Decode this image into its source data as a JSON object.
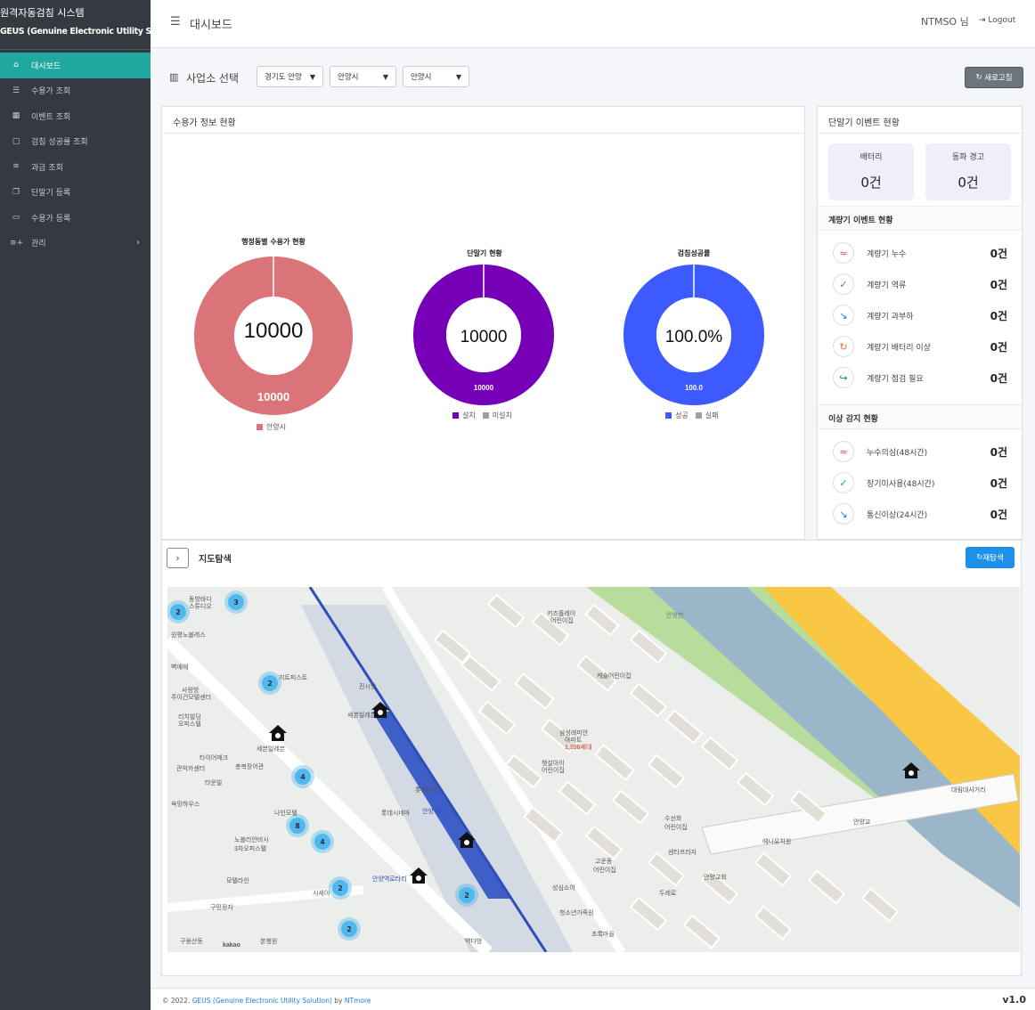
{
  "sidebar": {
    "title": "원격자동검침 시스템",
    "subtitle": "GEUS (Genuine Electronic Utility Solution)",
    "items": [
      {
        "label": "대시보드",
        "icon": "home-icon"
      },
      {
        "label": "수용가 조회",
        "icon": "list-icon"
      },
      {
        "label": "이벤트 조회",
        "icon": "grid-icon"
      },
      {
        "label": "검침 성공률 조회",
        "icon": "document-icon"
      },
      {
        "label": "과금 조회",
        "icon": "coins-icon"
      },
      {
        "label": "단말기 등록",
        "icon": "copy-icon"
      },
      {
        "label": "수용가 등록",
        "icon": "clipboard-icon"
      },
      {
        "label": "관리",
        "icon": "add-list-icon"
      }
    ]
  },
  "header": {
    "title": "대시보드",
    "user": "NTMSO 님",
    "logout": "Logout"
  },
  "site": {
    "label": "사업소 선택",
    "selects": [
      "경기도 안양",
      "안양시",
      "안양시"
    ],
    "refresh": "새로고침"
  },
  "consumer": {
    "title": "수용가 정보 현황",
    "charts": [
      {
        "title": "행정동별 수용가 현황",
        "center": "10000",
        "label": "10000",
        "legend": [
          "안양시"
        ]
      },
      {
        "title": "단말기 현황",
        "center": "10000",
        "label": "10000",
        "legend": [
          "설치",
          "미설치"
        ]
      },
      {
        "title": "검침성공률",
        "center": "100.0%",
        "label": "100.0",
        "legend": [
          "성공",
          "실패"
        ]
      }
    ]
  },
  "chart_data": [
    {
      "type": "pie",
      "title": "행정동별 수용가 현황",
      "categories": [
        "안양시"
      ],
      "values": [
        10000
      ],
      "colors": [
        "#db7479"
      ]
    },
    {
      "type": "pie",
      "title": "단말기 현황",
      "categories": [
        "설치",
        "미설치"
      ],
      "values": [
        10000,
        0
      ],
      "colors": [
        "#7600b8",
        "#a0a0a0"
      ]
    },
    {
      "type": "pie",
      "title": "검침성공률",
      "categories": [
        "성공",
        "실패"
      ],
      "values": [
        100.0,
        0
      ],
      "colors": [
        "#3d5afe",
        "#a0a0a0"
      ]
    }
  ],
  "terminal": {
    "title": "단말기 이벤트 현황",
    "boxes": [
      {
        "label": "배터리",
        "value": "0건"
      },
      {
        "label": "동파 경고",
        "value": "0건"
      }
    ],
    "meter_title": "계량기 이벤트 현황",
    "meter_events": [
      {
        "label": "계량기 누수",
        "value": "0건",
        "icon": "leak-icon",
        "color": "#e0405a"
      },
      {
        "label": "계량기 역류",
        "value": "0건",
        "icon": "check-icon",
        "color": "#28a745"
      },
      {
        "label": "계량기 과부하",
        "value": "0건",
        "icon": "overload-icon",
        "color": "#1e7fd8"
      },
      {
        "label": "계량기 배터리 이상",
        "value": "0건",
        "icon": "rotate-icon",
        "color": "#f06a2a"
      },
      {
        "label": "계량기 점검 필요",
        "value": "0건",
        "icon": "share-icon",
        "color": "#138a70"
      }
    ],
    "anomaly_title": "이상 감지 현황",
    "anomalies": [
      {
        "label": "누수의심(48시간)",
        "value": "0건",
        "icon": "leak-icon",
        "color": "#e0405a"
      },
      {
        "label": "장기미사용(48시간)",
        "value": "0건",
        "icon": "check-icon",
        "color": "#28a745"
      },
      {
        "label": "통신이상(24시간)",
        "value": "0건",
        "icon": "overload-icon",
        "color": "#1e7fd8"
      }
    ]
  },
  "map": {
    "title": "지도탐색",
    "rescan": "재탐색",
    "labels": [
      "동방바디",
      "스튜디오",
      "원평노블레스",
      "벽에에",
      "사랑방",
      "주이건모텔센터",
      "리치빌딩",
      "오피스텔",
      "타이어매크",
      "관악카센터",
      "총복장어관",
      "타운빌",
      "욕망하우스",
      "나인모텔",
      "노블리안비시",
      "3차오피스텔",
      "시세이",
      "모텔라인",
      "구민정자",
      "본행원",
      "백다방",
      "세븐일레븐",
      "지트피스트",
      "세본빌레븐",
      "진시앙",
      "롯데시네마",
      "안양역사",
      "안양역로타리",
      "롯데마트",
      "성심소어",
      "청소년가족원",
      "초록마을",
      "센타프라자",
      "두레로",
      "안양교회",
      "에나유치원",
      "수선화",
      "어린이집",
      "고운동",
      "어린이집",
      "삼성래미안",
      "아파트",
      "1,398세대",
      "캐슬어린이집",
      "햇살아이",
      "어린이집",
      "키즈플레이",
      "어린이집",
      "안양천",
      "안양교",
      "대림대사거리",
      "구용산동",
      "kakao"
    ],
    "clusters": [
      "2",
      "3",
      "2",
      "4",
      "8",
      "4",
      "2",
      "2",
      "2"
    ]
  },
  "footer": {
    "copyright": "© 2022.",
    "product": "GEUS (Genuine Electronic Utility Solution)",
    "by": "by",
    "company": "NTmore",
    "version": "v1.0"
  }
}
